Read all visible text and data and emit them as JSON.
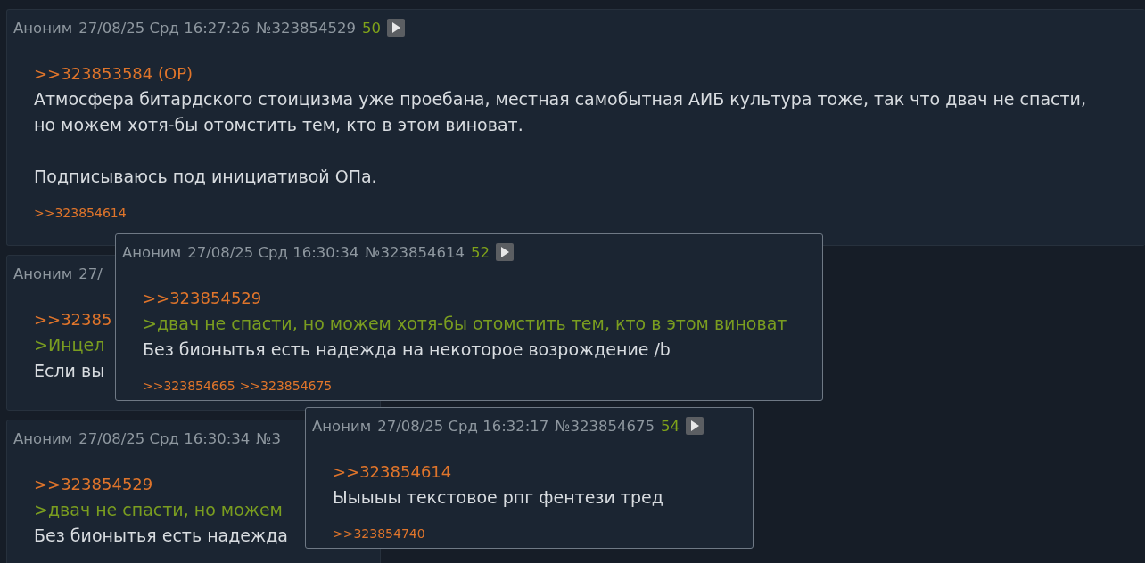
{
  "thread_posts": [
    {
      "header": {
        "name": "Аноним",
        "date": "27/08/25 Срд 16:27:26",
        "number": "№323854529",
        "count": "50",
        "play": true
      },
      "lines": [
        {
          "kind": "reply",
          "text": ">>323853584 (OP)"
        },
        {
          "kind": "text",
          "text": "Атмосфера битардского стоицизма уже проебана, местная самобытная АИБ культура тоже, так что двач не спасти,"
        },
        {
          "kind": "text",
          "text": "но можем хотя-бы отомстить тем, кто в этом виноват."
        },
        {
          "kind": "blank"
        },
        {
          "kind": "text",
          "text": "Подписываюсь под инициативой ОПа."
        }
      ],
      "backlinks": [
        ">>323854614"
      ]
    },
    {
      "header": {
        "name": "Аноним",
        "date": "27/"
      },
      "lines": [
        {
          "kind": "reply",
          "text": ">>32385"
        },
        {
          "kind": "quote",
          "text": ">Инцел"
        },
        {
          "kind": "text",
          "text": "Если вы"
        }
      ]
    },
    {
      "header": {
        "name": "Аноним",
        "date": "27/08/25 Срд 16:30:34",
        "number": "№3"
      },
      "lines": [
        {
          "kind": "reply",
          "text": ">>323854529"
        },
        {
          "kind": "quote",
          "text": ">двач не спасти, но можем"
        },
        {
          "kind": "text",
          "text": "Без бионытья есть надежда"
        }
      ]
    }
  ],
  "popups": [
    {
      "header": {
        "name": "Аноним",
        "date": "27/08/25 Срд 16:30:34",
        "number": "№323854614",
        "count": "52",
        "play": true
      },
      "lines": [
        {
          "kind": "reply",
          "text": ">>323854529"
        },
        {
          "kind": "quote",
          "text": ">двач не спасти, но можем хотя-бы отомстить тем, кто в этом виноват"
        },
        {
          "kind": "text",
          "text": "Без бионытья есть надежда на некоторое возрождение /b"
        }
      ],
      "backlinks": [
        ">>323854665",
        ">>323854675"
      ]
    },
    {
      "header": {
        "name": "Аноним",
        "date": "27/08/25 Срд 16:32:17",
        "number": "№323854675",
        "count": "54",
        "play": true
      },
      "lines": [
        {
          "kind": "reply",
          "text": ">>323854614"
        },
        {
          "kind": "text",
          "text": "Ыыыыы текстовое рпг фентези тред"
        }
      ],
      "backlinks": [
        ">>323854740"
      ]
    }
  ]
}
